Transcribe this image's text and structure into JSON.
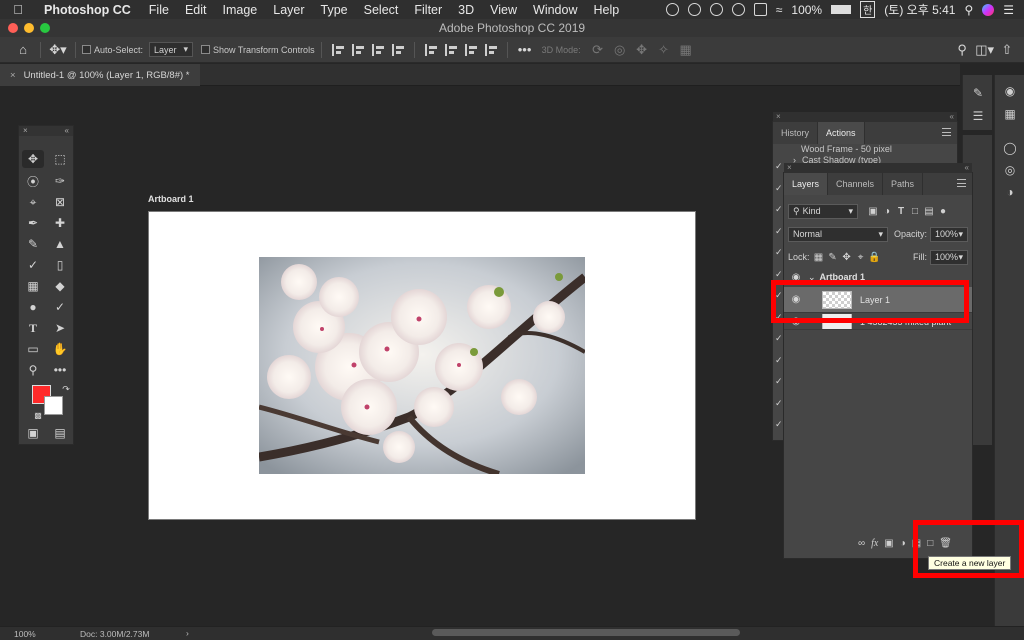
{
  "menubar": {
    "app_name": "Photoshop CC",
    "items": [
      "File",
      "Edit",
      "Image",
      "Layer",
      "Type",
      "Select",
      "Filter",
      "3D",
      "View",
      "Window",
      "Help"
    ],
    "battery": "100%",
    "input_method": "한",
    "clock": "(토) 오후 5:41"
  },
  "window": {
    "title": "Adobe Photoshop CC 2019"
  },
  "options_bar": {
    "auto_select_label": "Auto-Select:",
    "auto_select_value": "Layer",
    "transform_controls_label": "Show Transform Controls",
    "mode_3d_label": "3D Mode:"
  },
  "document": {
    "tab_title": "Untitled-1 @ 100% (Layer 1, RGB/8#) *",
    "artboard_label": "Artboard 1"
  },
  "history_panel": {
    "tabs": [
      "History",
      "Actions"
    ],
    "active_tab": "Actions",
    "action_items": [
      "Wood Frame - 50 pixel",
      "Cast Shadow (type)"
    ]
  },
  "layers_panel": {
    "tabs": [
      "Layers",
      "Channels",
      "Paths"
    ],
    "active_tab": "Layers",
    "filter_kind": "Kind",
    "blend_mode": "Normal",
    "opacity_label": "Opacity:",
    "opacity_value": "100%",
    "lock_label": "Lock:",
    "fill_label": "Fill:",
    "fill_value": "100%",
    "artboard_group": "Artboard 1",
    "layers": [
      {
        "name": "Layer 1",
        "selected": true
      },
      {
        "name": "1 4582455 mixed plant",
        "selected": false
      }
    ],
    "tooltip": "Create a new layer"
  },
  "toolbar": {
    "foreground_color": "#ff2a2a",
    "background_color": "#ffffff"
  },
  "status": {
    "zoom": "100%",
    "doc_size": "Doc: 3.00M/2.73M"
  },
  "colors": {
    "highlight": "#ff0000",
    "panel_bg": "#464646",
    "canvas_bg": "#262626"
  }
}
